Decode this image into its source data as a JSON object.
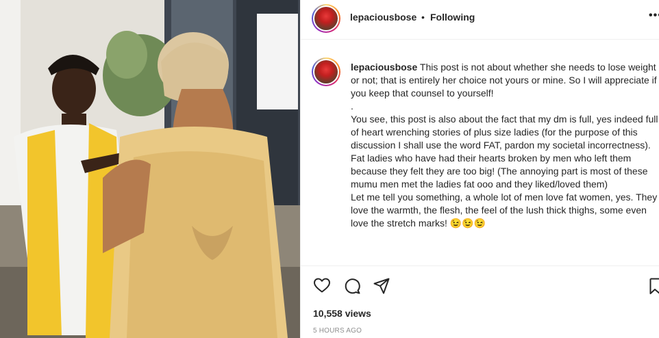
{
  "post": {
    "username": "lepaciousbose",
    "separator": "•",
    "follow_status": "Following",
    "more_label": "•••"
  },
  "caption": {
    "username": "lepaciousbose",
    "text": " This post is not about whether she needs to lose weight or not; that is entirely her choice not yours or mine. So I will appreciate if you keep that counsel to yourself!\n.\nYou see, this post is also about the fact that my dm is full, yes indeed full of heart wrenching stories of plus size ladies (for the purpose of this discussion I shall use the word FAT, pardon my societal incorrectness). Fat ladies who have had their hearts broken by men who left them because they felt they are too big! (The annoying part is most of these mumu men met the ladies fat ooo and they liked/loved them)\nLet me tell you something, a whole lot of men love fat women, yes. They love the warmth, the flesh, the feel of the lush thick thighs, some even love the stretch marks! 😉😉😉"
  },
  "icons": {
    "like": "heart-icon",
    "comment": "comment-icon",
    "share": "share-icon",
    "save": "bookmark-icon"
  },
  "stats": {
    "views": "10,558 views",
    "time": "5 HOURS AGO"
  },
  "colors": {
    "text": "#262626",
    "muted": "#8e8e8e",
    "divider": "#efefef"
  }
}
